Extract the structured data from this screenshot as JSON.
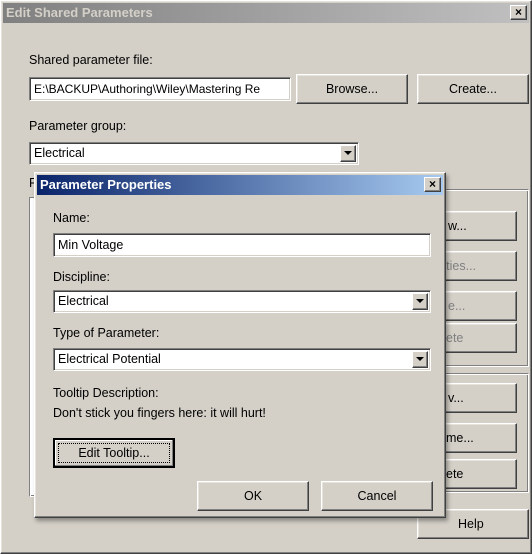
{
  "back_dialog": {
    "title": "Edit Shared Parameters",
    "close_glyph": "×",
    "file_label": "Shared parameter file:",
    "file_value": "E:\\BACKUP\\Authoring\\Wiley\\Mastering Re",
    "browse_label": "Browse...",
    "create_label": "Create...",
    "group_label": "Parameter group:",
    "group_value": "Electrical",
    "params_label_fragment": "P",
    "side_buttons": [
      "w...",
      "rties...",
      "e...",
      "ete",
      "v...",
      "me...",
      "ete"
    ],
    "help_label": "Help"
  },
  "front_dialog": {
    "title": "Parameter Properties",
    "close_glyph": "×",
    "name_label": "Name:",
    "name_value": "Min Voltage",
    "discipline_label": "Discipline:",
    "discipline_value": "Electrical",
    "type_label": "Type of Parameter:",
    "type_value": "Electrical Potential",
    "tooltip_label": "Tooltip Description:",
    "tooltip_text": "Don't stick you fingers here: it will hurt!",
    "edit_tooltip_label": "Edit Tooltip...",
    "ok_label": "OK",
    "cancel_label": "Cancel"
  }
}
